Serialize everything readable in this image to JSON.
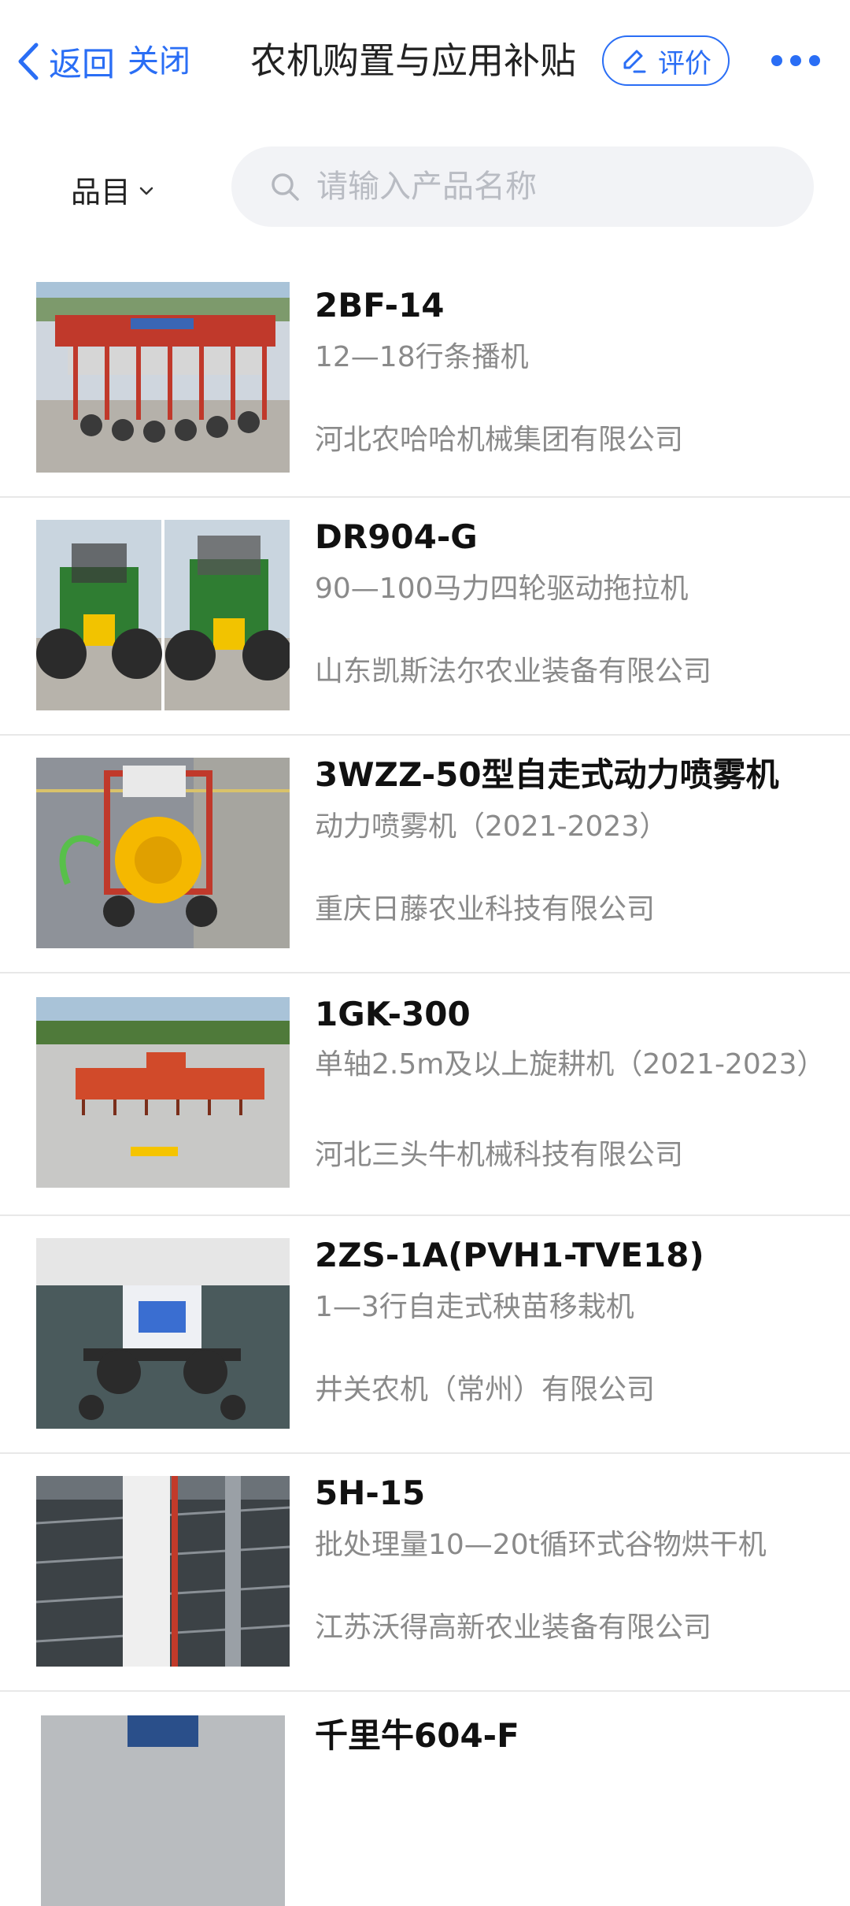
{
  "nav": {
    "back_label": "返回",
    "close_label": "关闭",
    "title": "农机购置与应用补贴",
    "rate_label": "评价"
  },
  "filter": {
    "category_label": "品目",
    "search_placeholder": "请输入产品名称"
  },
  "products": [
    {
      "model": "2BF-14",
      "category": "12—18行条播机",
      "company": "河北农哈哈机械集团有限公司"
    },
    {
      "model": "DR904-G",
      "category": "90—100马力四轮驱动拖拉机",
      "company": "山东凯斯法尔农业装备有限公司"
    },
    {
      "model": "3WZZ-50型自走式动力喷雾机",
      "category": "动力喷雾机（2021-2023）",
      "company": "重庆日藤农业科技有限公司"
    },
    {
      "model": "1GK-300",
      "category": "单轴2.5m及以上旋耕机（2021-2023）",
      "company": "河北三头牛机械科技有限公司"
    },
    {
      "model": "2ZS-1A(PVH1-TVE18)",
      "category": "1—3行自走式秧苗移栽机",
      "company": "井关农机（常州）有限公司"
    },
    {
      "model": "5H-15",
      "category": "批处理量10—20t循环式谷物烘干机",
      "company": "江苏沃得高新农业装备有限公司"
    },
    {
      "model": "千里牛604-F",
      "category": "",
      "company": ""
    }
  ],
  "colors": {
    "accent": "#2a6ef5",
    "title": "#222222",
    "secondary_text": "#8a8a8a",
    "divider": "#e8e8e8"
  },
  "icons": {
    "back": "chevron-left-icon",
    "rate": "pencil-icon",
    "more": "more-dots-icon",
    "search": "search-icon",
    "dropdown": "chevron-down-icon"
  }
}
